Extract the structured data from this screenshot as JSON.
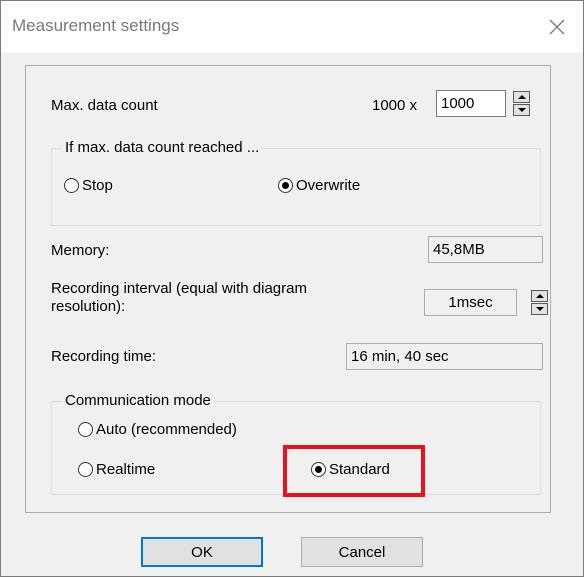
{
  "window": {
    "title": "Measurement settings"
  },
  "max_data_count": {
    "label": "Max. data count",
    "multiplier": "1000 x",
    "value": "1000"
  },
  "limit_group": {
    "legend": "If max. data count reached ...",
    "options": [
      {
        "label": "Stop",
        "checked": false
      },
      {
        "label": "Overwrite",
        "checked": true
      }
    ]
  },
  "memory": {
    "label": "Memory:",
    "value": "45,8MB"
  },
  "recording_interval": {
    "label_line1": "Recording interval (equal with diagram",
    "label_line2": "resolution):",
    "value": "1msec"
  },
  "recording_time": {
    "label": "Recording time:",
    "value": "16 min, 40 sec"
  },
  "communication_group": {
    "legend": "Communication mode",
    "options": [
      {
        "label": "Auto (recommended)",
        "checked": false
      },
      {
        "label": "Realtime",
        "checked": false
      },
      {
        "label": "Standard",
        "checked": true
      }
    ]
  },
  "buttons": {
    "ok": "OK",
    "cancel": "Cancel"
  },
  "colors": {
    "highlight": "#e8121f",
    "default_button_border": "#0078d7"
  }
}
